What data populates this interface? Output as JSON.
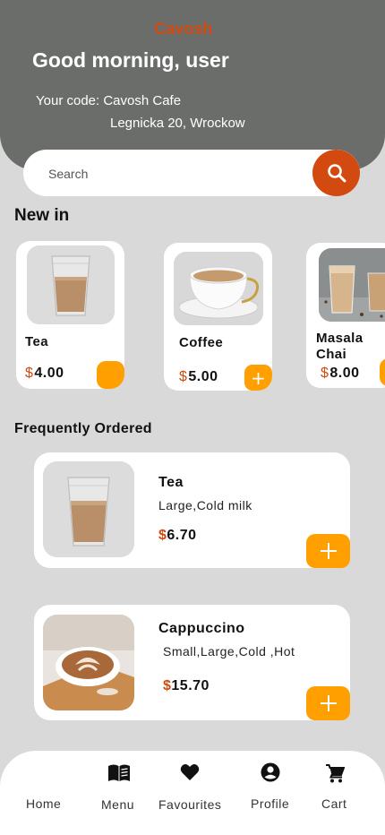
{
  "header": {
    "brand": "Cavosh",
    "greeting": "Good morning, user",
    "code_line": "Your code: Cavosh Cafe",
    "address": "Legnicka 20, Wrockow"
  },
  "search": {
    "placeholder": "Search"
  },
  "new_in": {
    "title": "New in",
    "items": [
      {
        "name": "Tea",
        "currency": "$",
        "price": "4.00"
      },
      {
        "name": "Coffee",
        "currency": "$",
        "price": "5.00"
      },
      {
        "name": "Masala Chai",
        "currency": "$",
        "price": "8.00"
      }
    ]
  },
  "frequent": {
    "title": "Frequently Ordered",
    "items": [
      {
        "name": "Tea",
        "desc": "Large,Cold milk",
        "currency": "$",
        "price": "6.70"
      },
      {
        "name": "Cappuccino",
        "desc": "Small,Large,Cold ,Hot",
        "currency": "$",
        "price": "15.70"
      }
    ]
  },
  "nav": {
    "items": [
      {
        "label": "Home",
        "icon": "home-icon"
      },
      {
        "label": "Menu",
        "icon": "menu-book-icon"
      },
      {
        "label": "Favourites",
        "icon": "heart-icon"
      },
      {
        "label": "Profile",
        "icon": "profile-icon"
      },
      {
        "label": "Cart",
        "icon": "cart-icon"
      }
    ]
  },
  "colors": {
    "header_bg": "#6b6d6b",
    "brand": "#d24a0f",
    "accent_button": "#ff9f00",
    "search_button": "#d24a0f",
    "page_bg": "#d9d9d9"
  }
}
